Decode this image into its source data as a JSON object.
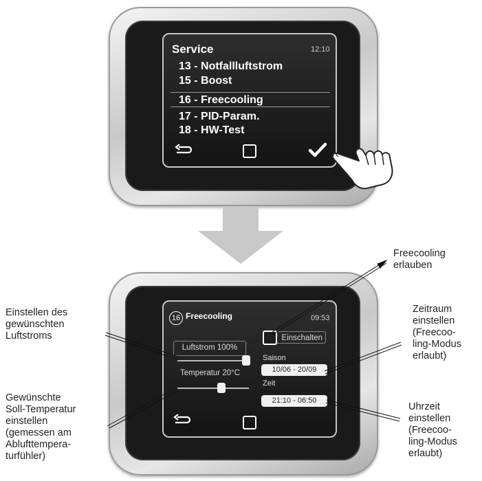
{
  "top_device": {
    "title": "Service",
    "time": "12:10",
    "menu": [
      {
        "number": "13",
        "label": "Notfallluftstrom"
      },
      {
        "number": "15",
        "label": "Boost"
      },
      {
        "number": "16",
        "label": "Freecooling"
      },
      {
        "number": "17",
        "label": "PID-Param."
      },
      {
        "number": "18",
        "label": "HW-Test"
      }
    ],
    "selected_item": "16"
  },
  "bottom_device": {
    "badge": "16",
    "title": "Freecooling",
    "time": "09:53",
    "checkbox_label": "Einschalten",
    "airflow_label": "Luftstrom 100%",
    "airflow_level": 1.0,
    "temperature_label": "Temperatur 20°C",
    "temperature_level": 0.5,
    "season_label": "Saison",
    "season_value": "10/06 - 20/09",
    "time_label": "Zeit",
    "time_value": "21:10 - 06:50"
  },
  "annotations": {
    "freecooling_allow": [
      "Freecooling",
      "erlauben"
    ],
    "airflow": [
      "Einstellen des",
      "gewünschten",
      "Luftstroms"
    ],
    "temperature": [
      "Gewünschte",
      "Soll-Temperatur",
      "einstellen",
      "(gemessen am",
      "Ablufttempera-",
      "turfühler)"
    ],
    "period": [
      "Zeitraum",
      "einstellen",
      "(Freecoo-",
      "ling-Modus",
      "erlaubt)"
    ],
    "clock_time": [
      "Uhrzeit",
      "einstellen",
      "(Freecoo-",
      "ling-Modus",
      "erlaubt)"
    ]
  }
}
